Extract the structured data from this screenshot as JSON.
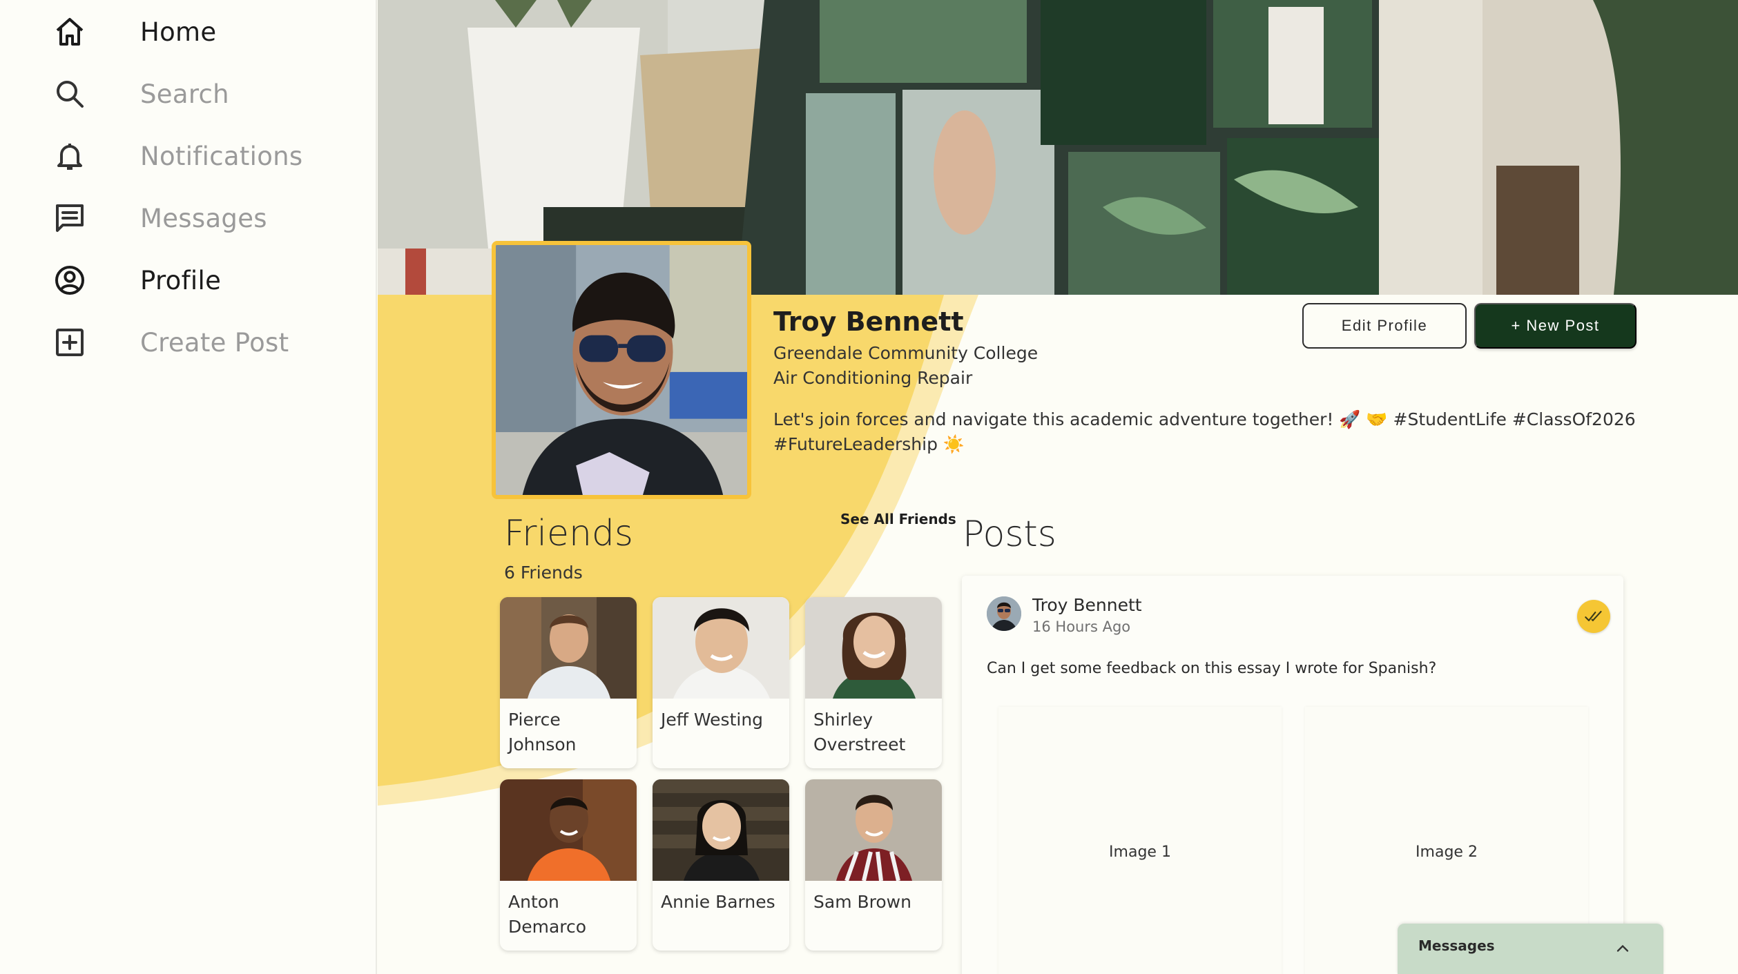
{
  "sidebar": {
    "items": [
      {
        "label": "Home",
        "icon": "home-icon",
        "active": true
      },
      {
        "label": "Search",
        "icon": "search-icon",
        "active": false
      },
      {
        "label": "Notifications",
        "icon": "bell-icon",
        "active": false
      },
      {
        "label": "Messages",
        "icon": "message-icon",
        "active": false
      },
      {
        "label": "Profile",
        "icon": "profile-icon",
        "active": true
      },
      {
        "label": "Create Post",
        "icon": "plus-square-icon",
        "active": false
      }
    ]
  },
  "profile": {
    "name": "Troy Bennett",
    "school": "Greendale Community College",
    "major": "Air Conditioning Repair",
    "bio": "Let's join forces and navigate this academic adventure together! 🚀 🤝 #StudentLife #ClassOf2026 #FutureLeadership ☀️",
    "edit_label": "Edit Profile",
    "new_post_label": "+ New Post"
  },
  "friends": {
    "title": "Friends",
    "count_label": "6 Friends",
    "see_all_label": "See All Friends",
    "list": [
      {
        "name": "Pierce Johnson"
      },
      {
        "name": "Jeff Westing"
      },
      {
        "name": "Shirley Overstreet"
      },
      {
        "name": "Anton Demarco"
      },
      {
        "name": "Annie Barnes"
      },
      {
        "name": "Sam Brown"
      }
    ]
  },
  "posts": {
    "title": "Posts",
    "items": [
      {
        "author": "Troy Bennett",
        "time": "16 Hours Ago",
        "text": "Can I get some feedback on this essay I wrote for Spanish?",
        "images": [
          "Image 1",
          "Image 2"
        ]
      }
    ]
  },
  "messages_bar": {
    "label": "Messages"
  },
  "colors": {
    "accent_yellow": "#f7c33a",
    "dark_green": "#15381d",
    "messages_bar_bg": "#c8dbc8",
    "page_bg": "#fdfdf6"
  }
}
